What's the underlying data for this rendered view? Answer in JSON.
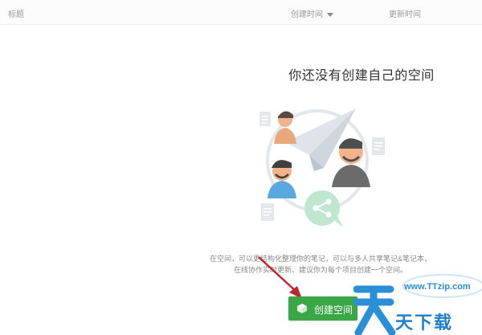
{
  "list_header": {
    "title_col": "标题",
    "created_col": "创建时间",
    "updated_col": "更新时间"
  },
  "empty_state": {
    "heading": "你还没有创建自己的空间",
    "description_line1": "在空间，可以更结构化整理你的笔记，可以与多人共享笔记&笔记本，",
    "description_line2": "在线协作实时更新。建议你为每个项目创建一个空间。",
    "create_button_label": "创建空间"
  },
  "watermark": {
    "url": "www.TTzip.com",
    "text": "天下载"
  },
  "colors": {
    "accent_green": "#3aa646",
    "annotation_arrow": "#c0272d",
    "watermark_blue": "#1f7fcc"
  },
  "icons": [
    "caret-down-icon",
    "space-cube-icon",
    "share-icon",
    "document-icon",
    "paper-plane-icon"
  ]
}
